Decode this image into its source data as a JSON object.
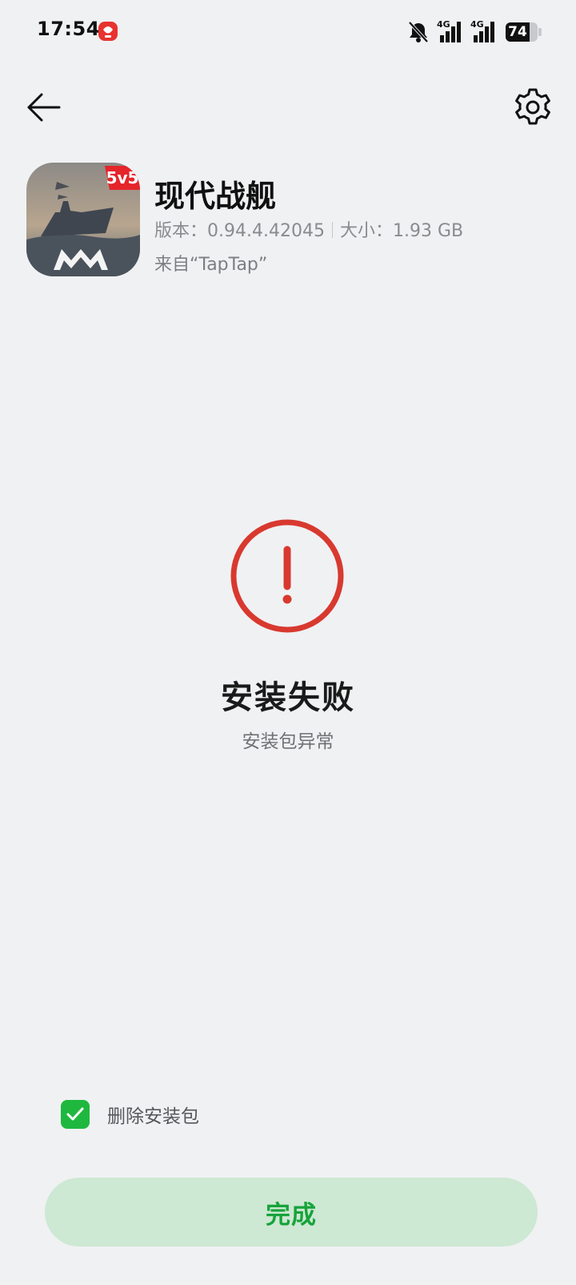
{
  "status_bar": {
    "time": "17:54",
    "network_1": "4G",
    "network_2": "4G",
    "battery_level": "74",
    "battery_fraction": 0.74,
    "icons": [
      "app-notification-badge-icon",
      "bell-muted-icon",
      "signal-4g-icon",
      "signal-4g-icon",
      "battery-icon"
    ]
  },
  "nav": {
    "back_icon": "arrow-left-icon",
    "settings_icon": "gear-icon"
  },
  "app": {
    "name": "现代战舰",
    "icon_badge": "5v5",
    "version_label": "版本：",
    "version": "0.94.4.42045",
    "size_label": "大小：",
    "size": "1.93 GB",
    "source": "来自“TapTap”"
  },
  "result": {
    "title": "安装失败",
    "subtitle": "安装包异常",
    "status_color": "#d8392f",
    "icon": "error-exclamation-circle-icon"
  },
  "options": {
    "delete_package_label": "删除安装包",
    "delete_package_checked": true,
    "check_color": "#1fb83f"
  },
  "actions": {
    "done_label": "完成",
    "done_bg": "#cde8d3",
    "done_text_color": "#17a33a"
  }
}
